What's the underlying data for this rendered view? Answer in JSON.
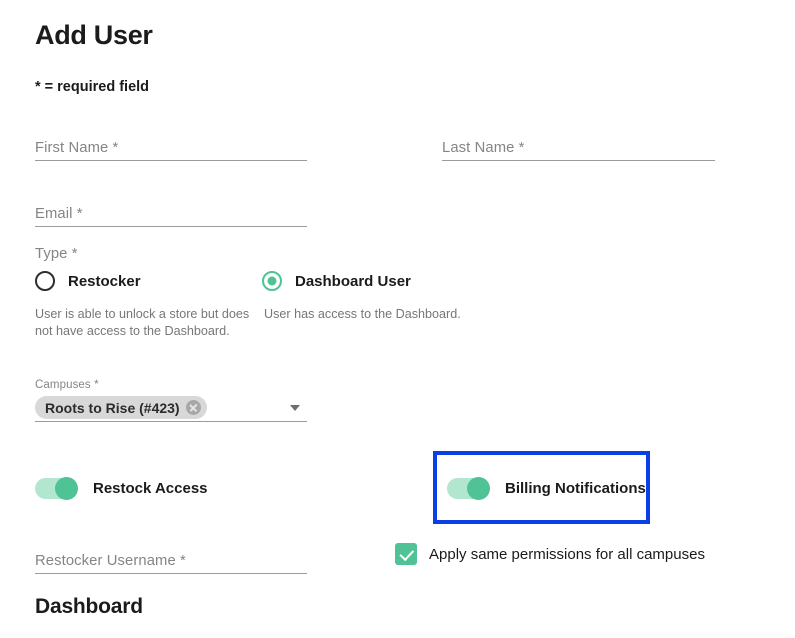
{
  "header": {
    "title": "Add User",
    "required_note": "* = required field"
  },
  "fields": {
    "first_name": {
      "label": "First Name *",
      "value": "",
      "placeholder": "First Name *"
    },
    "last_name": {
      "label": "Last Name *",
      "value": "",
      "placeholder": "Last Name *"
    },
    "email": {
      "label": "Email *",
      "value": "",
      "placeholder": "Email *"
    },
    "restocker_username": {
      "label": "Restocker Username *",
      "value": "",
      "placeholder": "Restocker Username *"
    }
  },
  "type_group": {
    "label": "Type *",
    "options": [
      {
        "label": "Restocker",
        "selected": false,
        "description": "User is able to unlock a store but does not have access to the Dashboard."
      },
      {
        "label": "Dashboard User",
        "selected": true,
        "description": "User has access to the Dashboard."
      }
    ]
  },
  "campuses": {
    "label": "Campuses *",
    "chips": [
      {
        "text": "Roots to Rise (#423)",
        "remove_icon": "close-circle-icon"
      }
    ],
    "dropdown_icon": "chevron-down-icon"
  },
  "toggles": [
    {
      "label": "Restock Access",
      "on": true
    },
    {
      "label": "Billing Notifications",
      "on": true,
      "highlighted": true
    }
  ],
  "checkbox": {
    "label": "Apply same permissions for all campuses",
    "checked": true
  },
  "sections": {
    "dashboard_heading": "Dashboard"
  },
  "colors": {
    "accent_green": "#4fc395",
    "toggle_track_green": "#b3e6cf",
    "highlight_blue": "#0a3fe8",
    "label_gray": "#858585",
    "underline_gray": "#9b9b9b",
    "chip_gray": "#d8d8d8",
    "text_dark": "#1b1b1b",
    "desc_gray": "#777777"
  }
}
